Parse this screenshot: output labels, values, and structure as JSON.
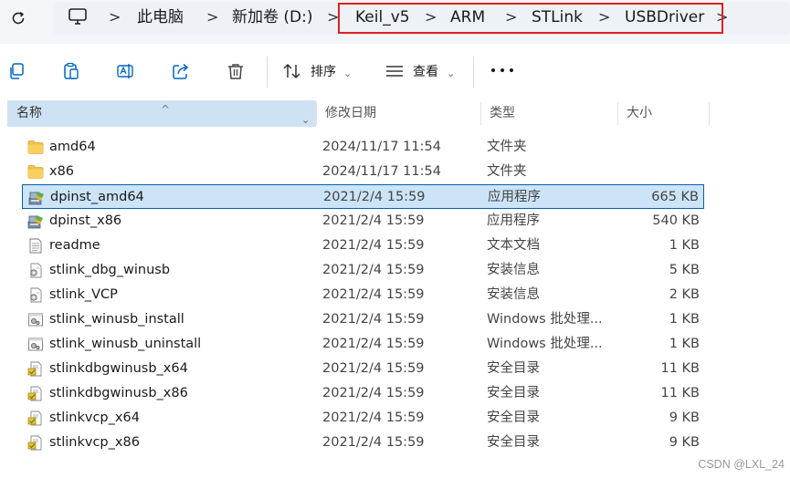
{
  "address_bar": {
    "breadcrumbs": [
      "此电脑",
      "新加卷 (D:)",
      "Keil_v5",
      "ARM",
      "STLink",
      "USBDriver"
    ],
    "separator": ">"
  },
  "toolbar": {
    "sort_label": "排序",
    "view_label": "查看",
    "dropdown_glyph": "⌄",
    "more_icon": "more-horizontal-icon"
  },
  "columns": {
    "name": "名称",
    "date": "修改日期",
    "type": "类型",
    "size": "大小",
    "sort_glyph": "^",
    "filter_glyph": "⌄"
  },
  "files": [
    {
      "name": "amd64",
      "date": "2024/11/17 11:54",
      "type": "文件夹",
      "size": "",
      "icon": "folder-icon",
      "selected": false
    },
    {
      "name": "x86",
      "date": "2024/11/17 11:54",
      "type": "文件夹",
      "size": "",
      "icon": "folder-icon",
      "selected": false
    },
    {
      "name": "dpinst_amd64",
      "date": "2021/2/4 15:59",
      "type": "应用程序",
      "size": "665 KB",
      "icon": "installer-app-icon",
      "selected": true
    },
    {
      "name": "dpinst_x86",
      "date": "2021/2/4 15:59",
      "type": "应用程序",
      "size": "540 KB",
      "icon": "installer-app-icon",
      "selected": false
    },
    {
      "name": "readme",
      "date": "2021/2/4 15:59",
      "type": "文本文档",
      "size": "1 KB",
      "icon": "text-file-icon",
      "selected": false
    },
    {
      "name": "stlink_dbg_winusb",
      "date": "2021/2/4 15:59",
      "type": "安装信息",
      "size": "5 KB",
      "icon": "setup-info-icon",
      "selected": false
    },
    {
      "name": "stlink_VCP",
      "date": "2021/2/4 15:59",
      "type": "安装信息",
      "size": "2 KB",
      "icon": "setup-info-icon",
      "selected": false
    },
    {
      "name": "stlink_winusb_install",
      "date": "2021/2/4 15:59",
      "type": "Windows 批处理...",
      "size": "1 KB",
      "icon": "batch-file-icon",
      "selected": false
    },
    {
      "name": "stlink_winusb_uninstall",
      "date": "2021/2/4 15:59",
      "type": "Windows 批处理...",
      "size": "1 KB",
      "icon": "batch-file-icon",
      "selected": false
    },
    {
      "name": "stlinkdbgwinusb_x64",
      "date": "2021/2/4 15:59",
      "type": "安全目录",
      "size": "11 KB",
      "icon": "security-catalog-icon",
      "selected": false
    },
    {
      "name": "stlinkdbgwinusb_x86",
      "date": "2021/2/4 15:59",
      "type": "安全目录",
      "size": "11 KB",
      "icon": "security-catalog-icon",
      "selected": false
    },
    {
      "name": "stlinkvcp_x64",
      "date": "2021/2/4 15:59",
      "type": "安全目录",
      "size": "9 KB",
      "icon": "security-catalog-icon",
      "selected": false
    },
    {
      "name": "stlinkvcp_x86",
      "date": "2021/2/4 15:59",
      "type": "安全目录",
      "size": "9 KB",
      "icon": "security-catalog-icon",
      "selected": false
    }
  ],
  "watermark": "CSDN @LXL_24",
  "colors": {
    "selection_bg": "#cce4f7",
    "selection_border": "#0a5fa8",
    "highlight_box": "#e02020",
    "folder": "#f2c14e"
  }
}
